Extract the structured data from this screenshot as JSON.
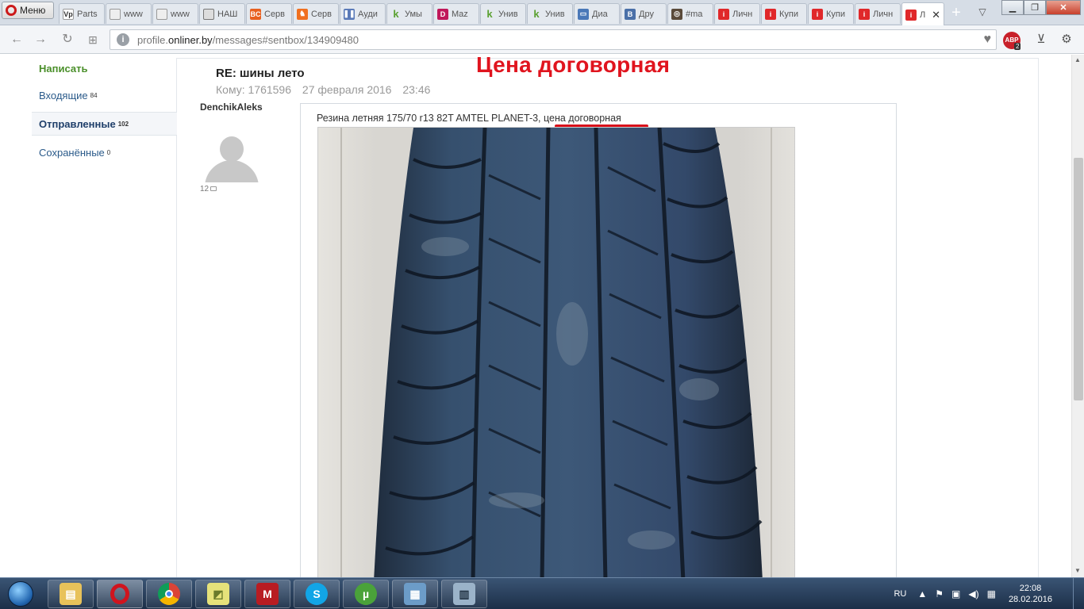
{
  "browser": {
    "menu_label": "Меню",
    "tabs": [
      {
        "label": "Parts",
        "icon": "rp-icon"
      },
      {
        "label": "www",
        "icon": "page-icon"
      },
      {
        "label": "www",
        "icon": "page-icon"
      },
      {
        "label": "НАШ",
        "icon": "doc-icon"
      },
      {
        "label": "Серв",
        "icon": "bc-icon"
      },
      {
        "label": "Серв",
        "icon": "horse-icon"
      },
      {
        "label": "Ауди",
        "icon": "pause-icon"
      },
      {
        "label": "Умы",
        "icon": "k-icon"
      },
      {
        "label": "Maz",
        "icon": "d-icon"
      },
      {
        "label": "Унив",
        "icon": "k-icon"
      },
      {
        "label": "Унив",
        "icon": "k-icon"
      },
      {
        "label": "Диа",
        "icon": "chat-icon"
      },
      {
        "label": "Дру",
        "icon": "vk-icon"
      },
      {
        "label": "#ma",
        "icon": "instagram-icon"
      },
      {
        "label": "Личн",
        "icon": "onliner-icon"
      },
      {
        "label": "Купи",
        "icon": "onliner-icon"
      },
      {
        "label": "Купи",
        "icon": "onliner-icon"
      },
      {
        "label": "Личн",
        "icon": "onliner-icon"
      },
      {
        "label": "Л",
        "icon": "onliner-icon"
      }
    ],
    "url_prefix": "profile.",
    "url_domain": "onliner.by",
    "url_path": "/messages#sentbox/134909480",
    "abp_label": "ABP",
    "abp_count": "2"
  },
  "sidebar": {
    "compose": "Написать",
    "items": [
      {
        "label": "Входящие",
        "count": "84"
      },
      {
        "label": "Отправленные",
        "count": "102"
      },
      {
        "label": "Сохранённые",
        "count": "0"
      }
    ]
  },
  "annotation": "Цена договорная",
  "message": {
    "subject": "RE: шины лето",
    "to": "Кому: 1761596",
    "date": "27 февраля 2016",
    "time": "23:46",
    "sender": "DenchikAleks",
    "sender_count": "12",
    "text": "Резина летняя 175/70 r13 82T AMTEL PLANET-3, цена договорная"
  },
  "taskbar": {
    "apps": [
      "explorer-icon",
      "opera-icon",
      "chrome-icon",
      "sticky-icon",
      "mcafee-icon",
      "skype-icon",
      "utorrent-icon",
      "control-panel-icon",
      "calculator-icon"
    ],
    "lang": "RU",
    "time": "22:08",
    "date": "28.02.2016"
  },
  "colors": {
    "accent_red": "#e0141e",
    "link_blue": "#2a5a8a",
    "compose_green": "#4a8f2a"
  }
}
